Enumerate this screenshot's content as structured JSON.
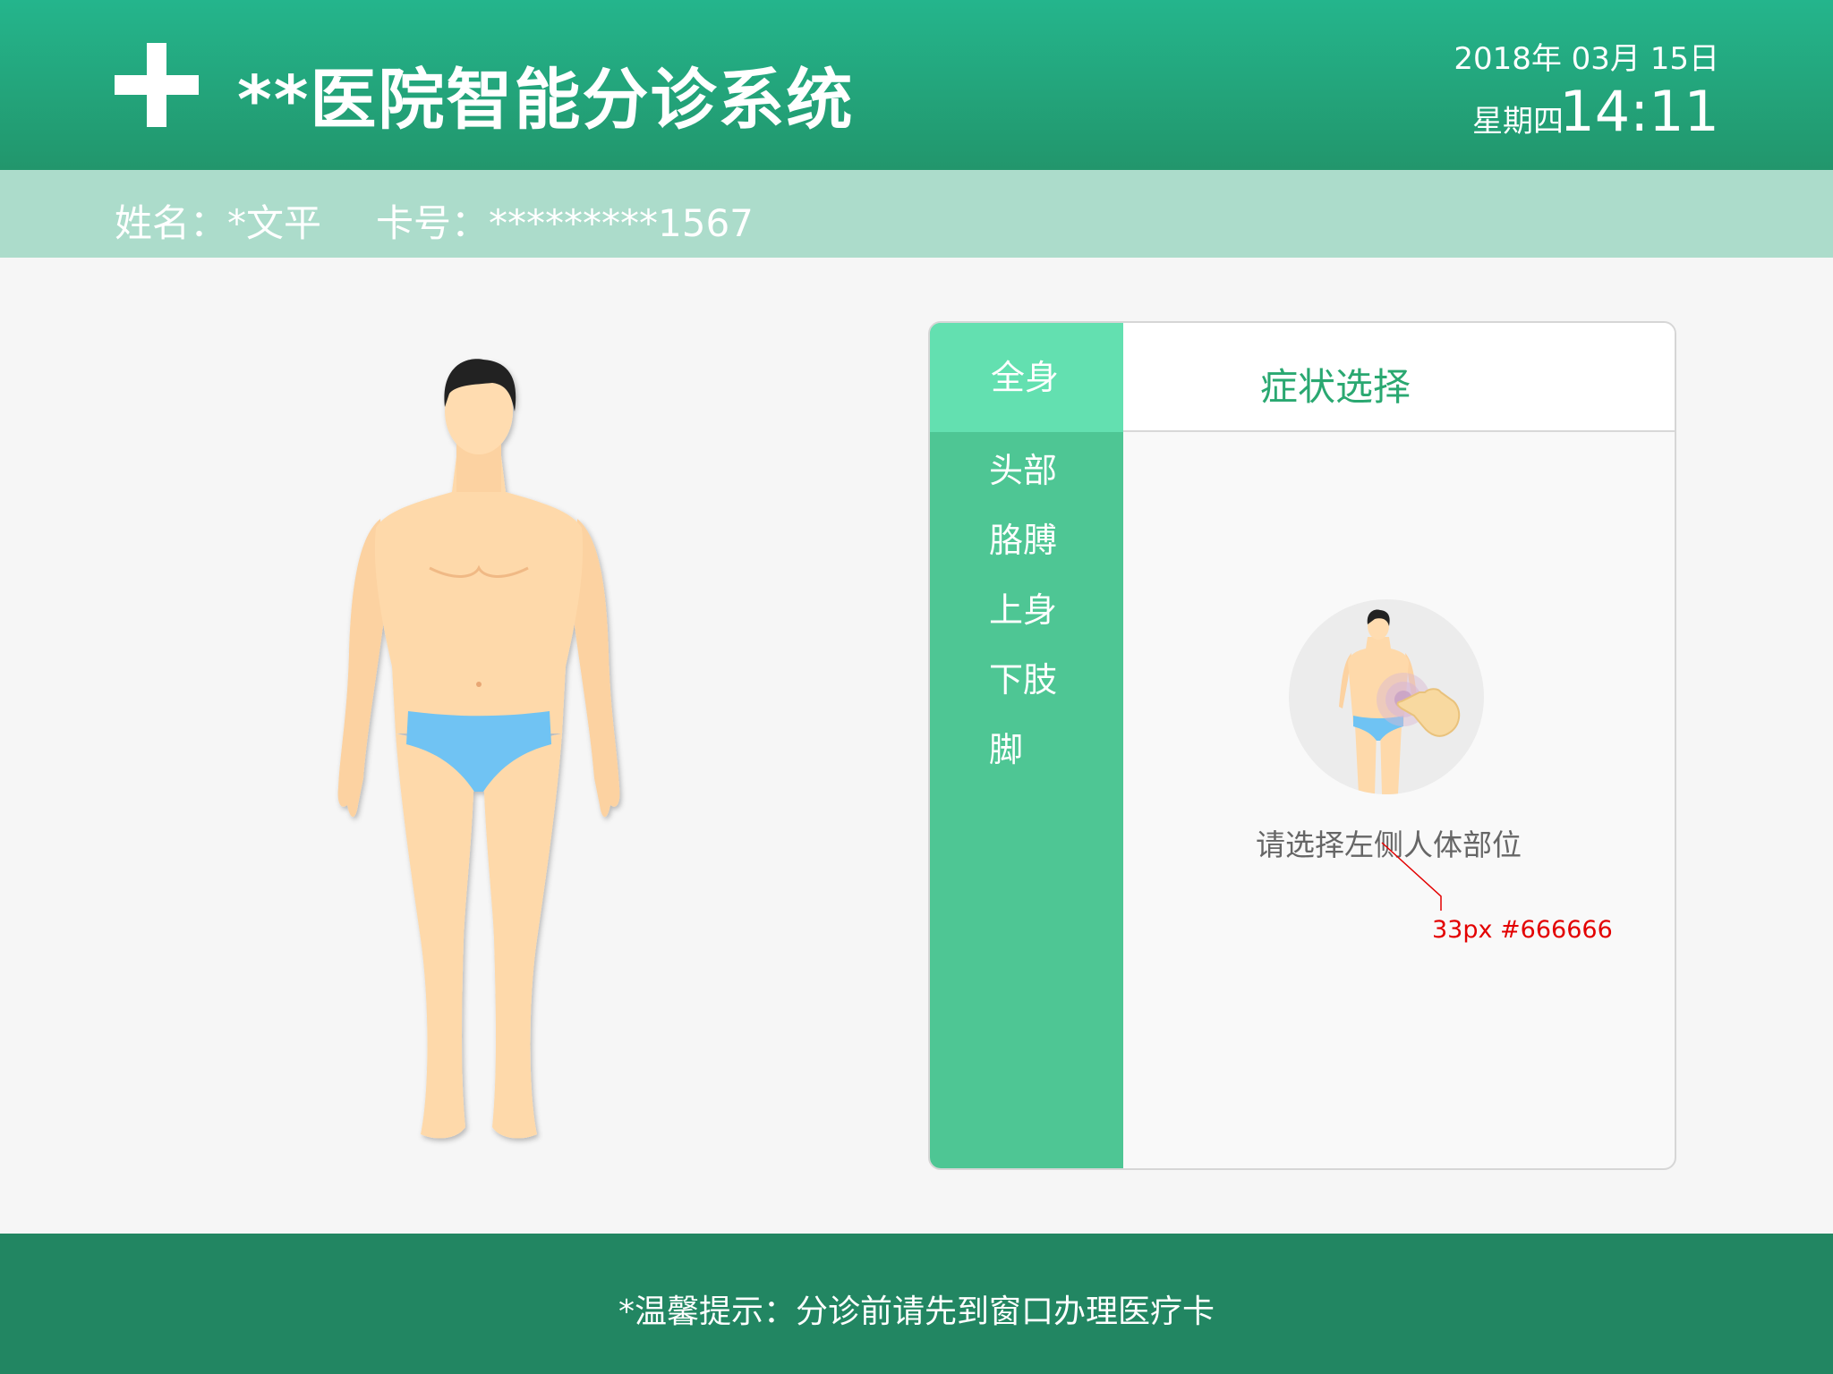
{
  "header": {
    "title": "**医院智能分诊系统",
    "date": "2018年 03月 15日",
    "weekday": "星期四",
    "time": "14:11"
  },
  "patient": {
    "name": "姓名：*文平",
    "card": "卡号：*********1567"
  },
  "panel": {
    "nav": [
      {
        "label": "全身",
        "active": true
      },
      {
        "label": "头部"
      },
      {
        "label": "胳膊"
      },
      {
        "label": "上身"
      },
      {
        "label": "下肢"
      },
      {
        "label": "脚"
      }
    ],
    "title": "症状选择",
    "hint": "请选择左侧人体部位"
  },
  "annotation": {
    "text": "33px  #666666"
  },
  "footer": {
    "tip": "*温馨提示：分诊前请先到窗口办理医疗卡"
  },
  "colors": {
    "header_top": "#24b58c",
    "header_bottom": "#22966c",
    "info_bar": "#acdccb",
    "nav_bg": "#4ec694",
    "nav_active": "#63e0b0",
    "footer": "#228662",
    "accent_text": "#2aa871"
  }
}
